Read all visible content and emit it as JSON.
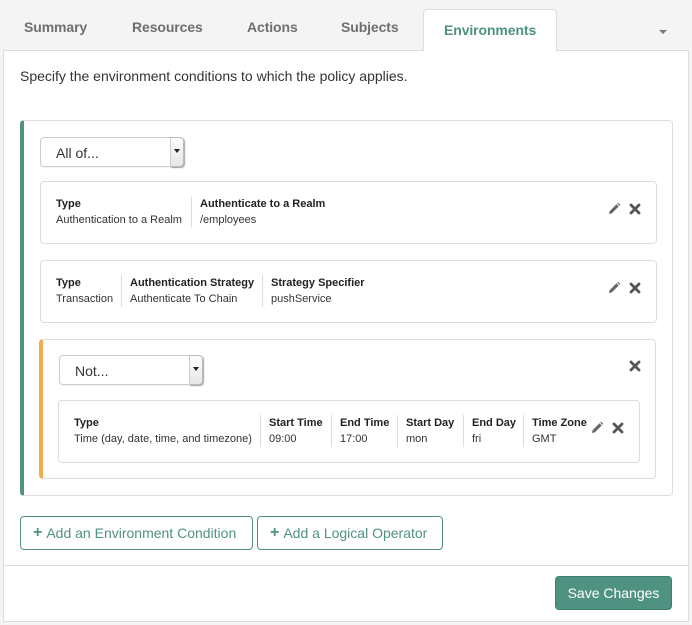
{
  "tabs": [
    {
      "label": "Summary",
      "active": false
    },
    {
      "label": "Resources",
      "active": false
    },
    {
      "label": "Actions",
      "active": false
    },
    {
      "label": "Subjects",
      "active": false
    },
    {
      "label": "Environments",
      "active": true
    }
  ],
  "intro": "Specify the environment conditions to which the policy applies.",
  "outer_group": {
    "operator": "All of...",
    "accent_color": "#4f9282",
    "conditions": [
      {
        "columns": [
          {
            "label": "Type",
            "value": "Authentication to a Realm"
          },
          {
            "label": "Authenticate to a Realm",
            "value": "/employees"
          }
        ]
      },
      {
        "columns": [
          {
            "label": "Type",
            "value": "Transaction"
          },
          {
            "label": "Authentication Strategy",
            "value": "Authenticate To Chain"
          },
          {
            "label": "Strategy Specifier",
            "value": "pushService"
          }
        ]
      }
    ],
    "inner_group": {
      "operator": "Not...",
      "accent_color": "#f0ad4e",
      "condition": {
        "columns": [
          {
            "label": "Type",
            "value": "Time (day, date, time, and timezone)"
          },
          {
            "label": "Start Time",
            "value": "09:00"
          },
          {
            "label": "End Time",
            "value": "17:00"
          },
          {
            "label": "Start Day",
            "value": "mon"
          },
          {
            "label": "End Day",
            "value": "fri"
          },
          {
            "label": "Time Zone",
            "value": "GMT"
          }
        ]
      }
    }
  },
  "buttons": {
    "add_condition": "Add an Environment Condition",
    "add_operator": "Add a Logical Operator",
    "plus_glyph": "+",
    "save": "Save Changes"
  },
  "icons": {
    "edit": "pencil-icon",
    "delete": "close-icon",
    "tab_menu": "caret-down-icon"
  }
}
